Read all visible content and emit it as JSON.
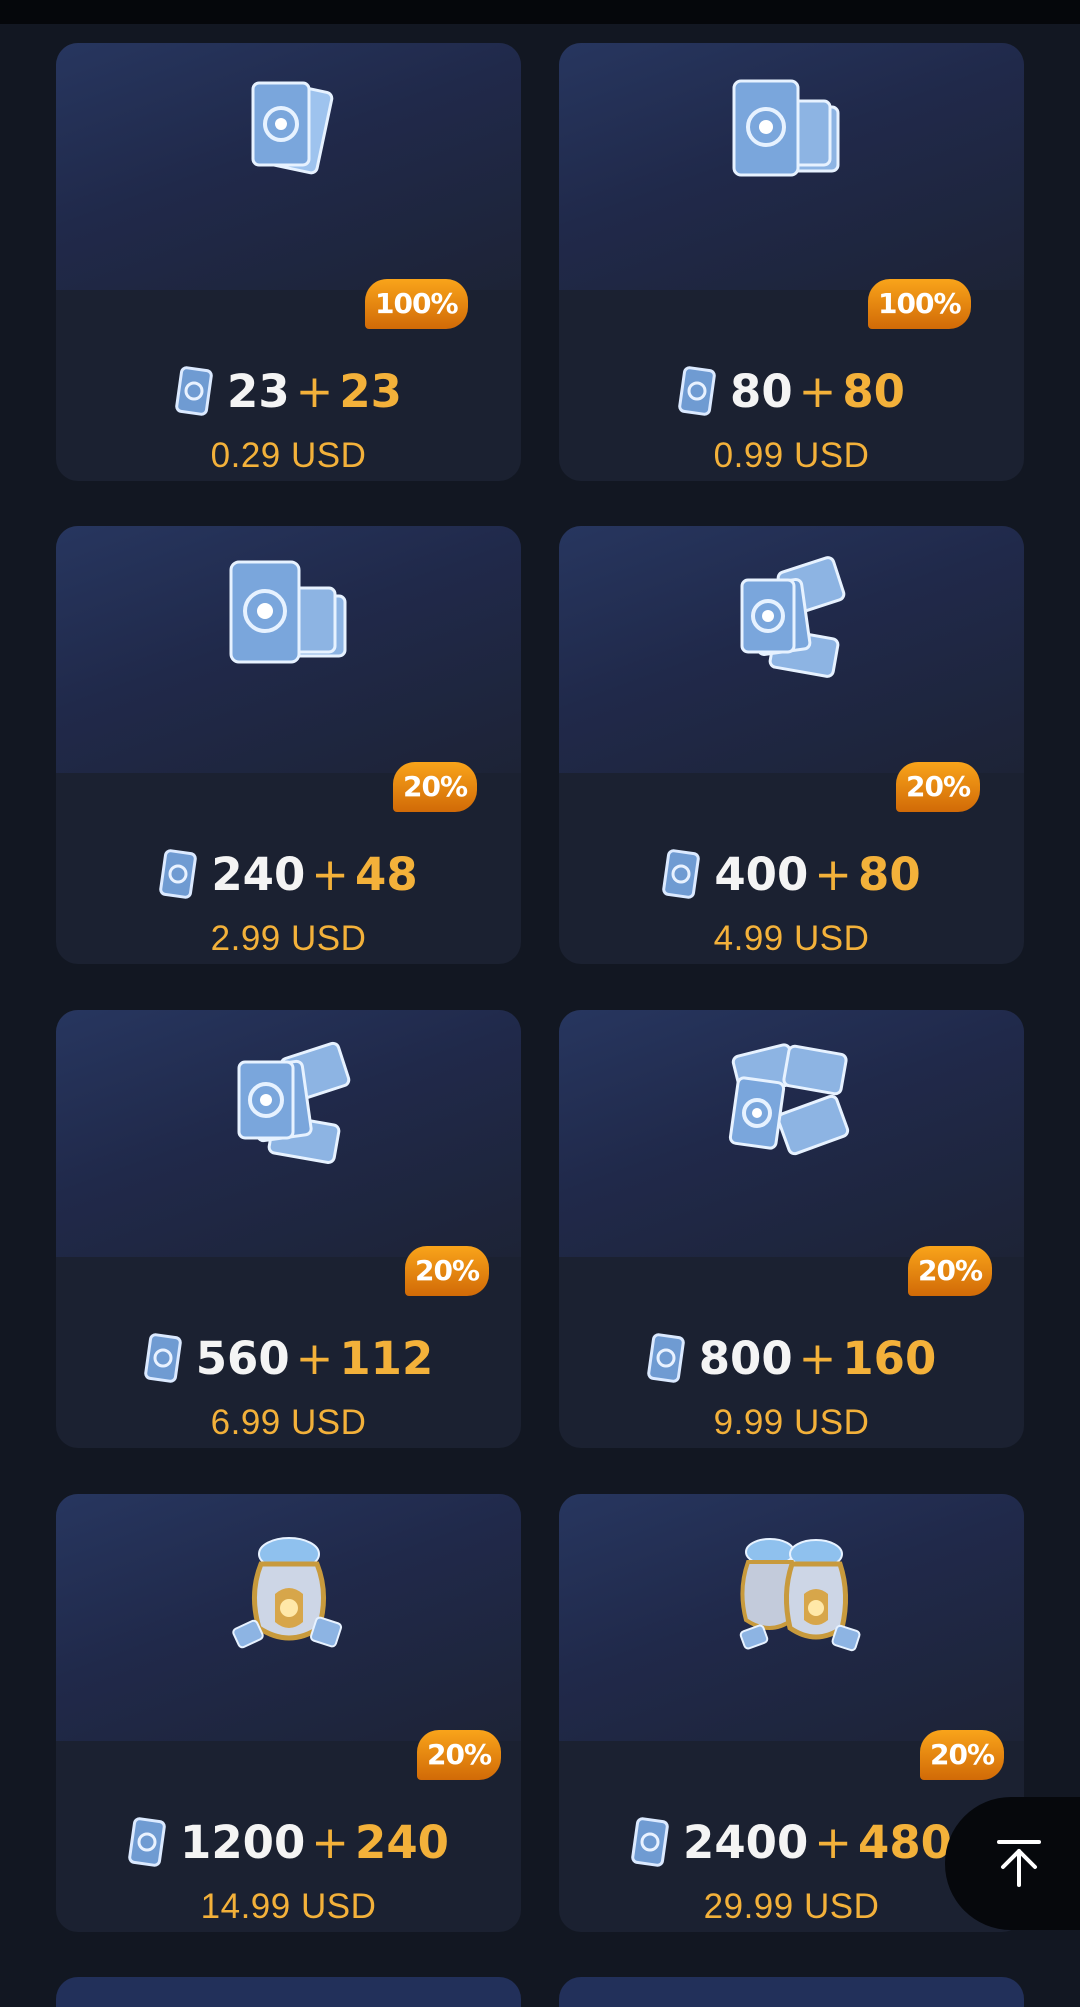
{
  "packs": [
    {
      "icon": "cards-small-icon",
      "badge": "100%",
      "base": "23",
      "plus": "+",
      "bonus": "23",
      "price": "0.29 USD"
    },
    {
      "icon": "cards-stack-icon",
      "badge": "100%",
      "base": "80",
      "plus": "+",
      "bonus": "80",
      "price": "0.99 USD"
    },
    {
      "icon": "cards-stack-icon",
      "badge": "20%",
      "base": "240",
      "plus": "+",
      "bonus": "48",
      "price": "2.99 USD"
    },
    {
      "icon": "cards-pile-icon",
      "badge": "20%",
      "base": "400",
      "plus": "+",
      "bonus": "80",
      "price": "4.99 USD"
    },
    {
      "icon": "cards-pile-icon",
      "badge": "20%",
      "base": "560",
      "plus": "+",
      "bonus": "112",
      "price": "6.99 USD"
    },
    {
      "icon": "cards-heap-icon",
      "badge": "20%",
      "base": "800",
      "plus": "+",
      "bonus": "160",
      "price": "9.99 USD"
    },
    {
      "icon": "card-bag-icon",
      "badge": "20%",
      "base": "1200",
      "plus": "+",
      "bonus": "240",
      "price": "14.99 USD"
    },
    {
      "icon": "card-bags-icon",
      "badge": "20%",
      "base": "2400",
      "plus": "+",
      "bonus": "480",
      "price": "29.99 USD"
    }
  ],
  "scroll_top": {
    "icon": "arrow-up-to-top-icon"
  },
  "colors": {
    "accent": "#f3b13a",
    "badge": "#e8870f",
    "card": "#1b2131",
    "background": "#121722"
  }
}
